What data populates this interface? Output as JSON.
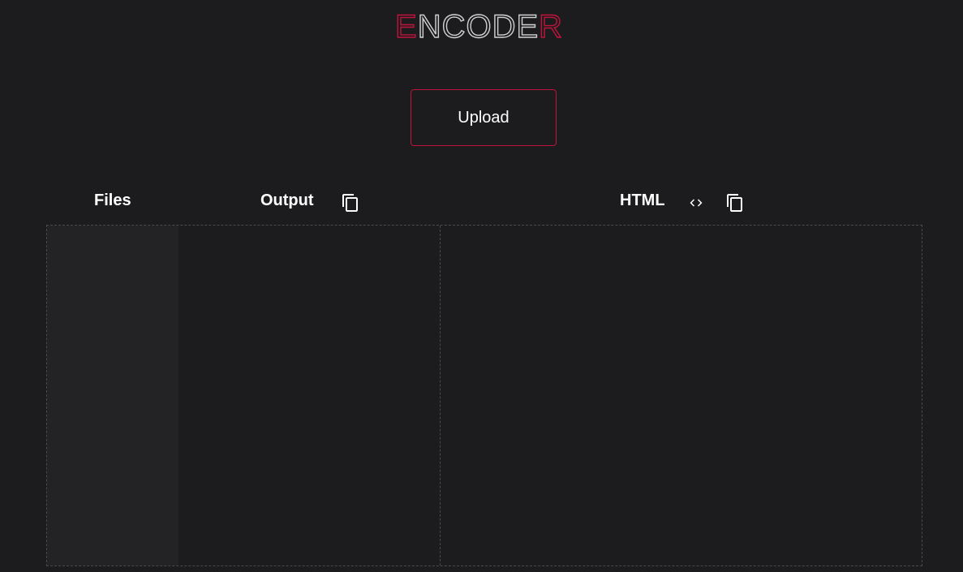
{
  "logo": {
    "text": "ENCODER",
    "accent_color": "#c0143c",
    "outline_color": "#d0d0d0"
  },
  "upload": {
    "label": "Upload",
    "border_color": "#c0143c"
  },
  "sections": {
    "files": {
      "label": "Files"
    },
    "output": {
      "label": "Output",
      "icon": "copy-icon"
    },
    "html": {
      "label": "HTML",
      "icons": [
        "code-icon",
        "copy-icon"
      ]
    }
  },
  "colors": {
    "background": "#1c1c1e",
    "files_panel": "#232326",
    "border": "#4a4a4e"
  }
}
